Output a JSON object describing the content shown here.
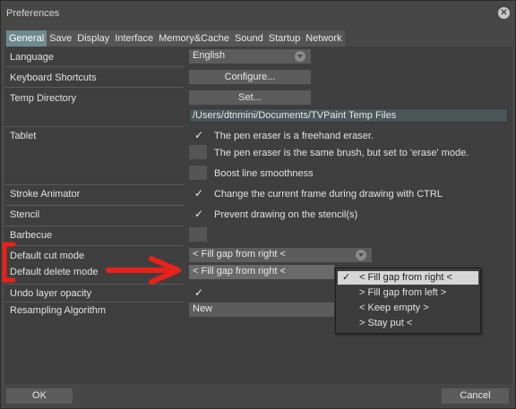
{
  "window": {
    "title": "Preferences"
  },
  "tabs": [
    "General",
    "Save",
    "Display",
    "Interface",
    "Memory&Cache",
    "Sound",
    "Startup",
    "Network"
  ],
  "settings": {
    "language": {
      "label": "Language",
      "value": "English"
    },
    "keyboard": {
      "label": "Keyboard Shortcuts",
      "button": "Configure..."
    },
    "temp": {
      "label": "Temp Directory",
      "button": "Set...",
      "path": "/Users/dtnmini/Documents/TVPaint Temp Files"
    },
    "tablet": {
      "label": "Tablet",
      "opt1": "The pen eraser is a freehand eraser.",
      "opt2": "The pen eraser is the same brush, but set to 'erase' mode.",
      "opt3": "Boost line smoothness"
    },
    "stroke": {
      "label": "Stroke Animator",
      "opt": "Change the current frame during drawing with CTRL"
    },
    "stencil": {
      "label": "Stencil",
      "opt": "Prevent drawing on the stencil(s)"
    },
    "barbecue": {
      "label": "Barbecue"
    },
    "cut_mode": {
      "label": "Default cut mode",
      "value": "< Fill gap from right <"
    },
    "delete_mode": {
      "label": "Default delete mode",
      "value": "< Fill gap from right <"
    },
    "undo_opacity": {
      "label": "Undo layer opacity"
    },
    "resampling": {
      "label": "Resampling Algorithm",
      "value": "New"
    }
  },
  "popup": {
    "items": [
      "< Fill gap from right <",
      "> Fill gap from left >",
      "< Keep empty >",
      "> Stay put <"
    ],
    "selected_index": 0
  },
  "footer": {
    "ok": "OK",
    "cancel": "Cancel"
  },
  "colors": {
    "annotation": "#e8221a",
    "active_tab": "#6f8a8f"
  },
  "icons": {
    "close": "close-icon",
    "check": "checkmark-icon",
    "dropdown": "chevron-down-icon"
  }
}
